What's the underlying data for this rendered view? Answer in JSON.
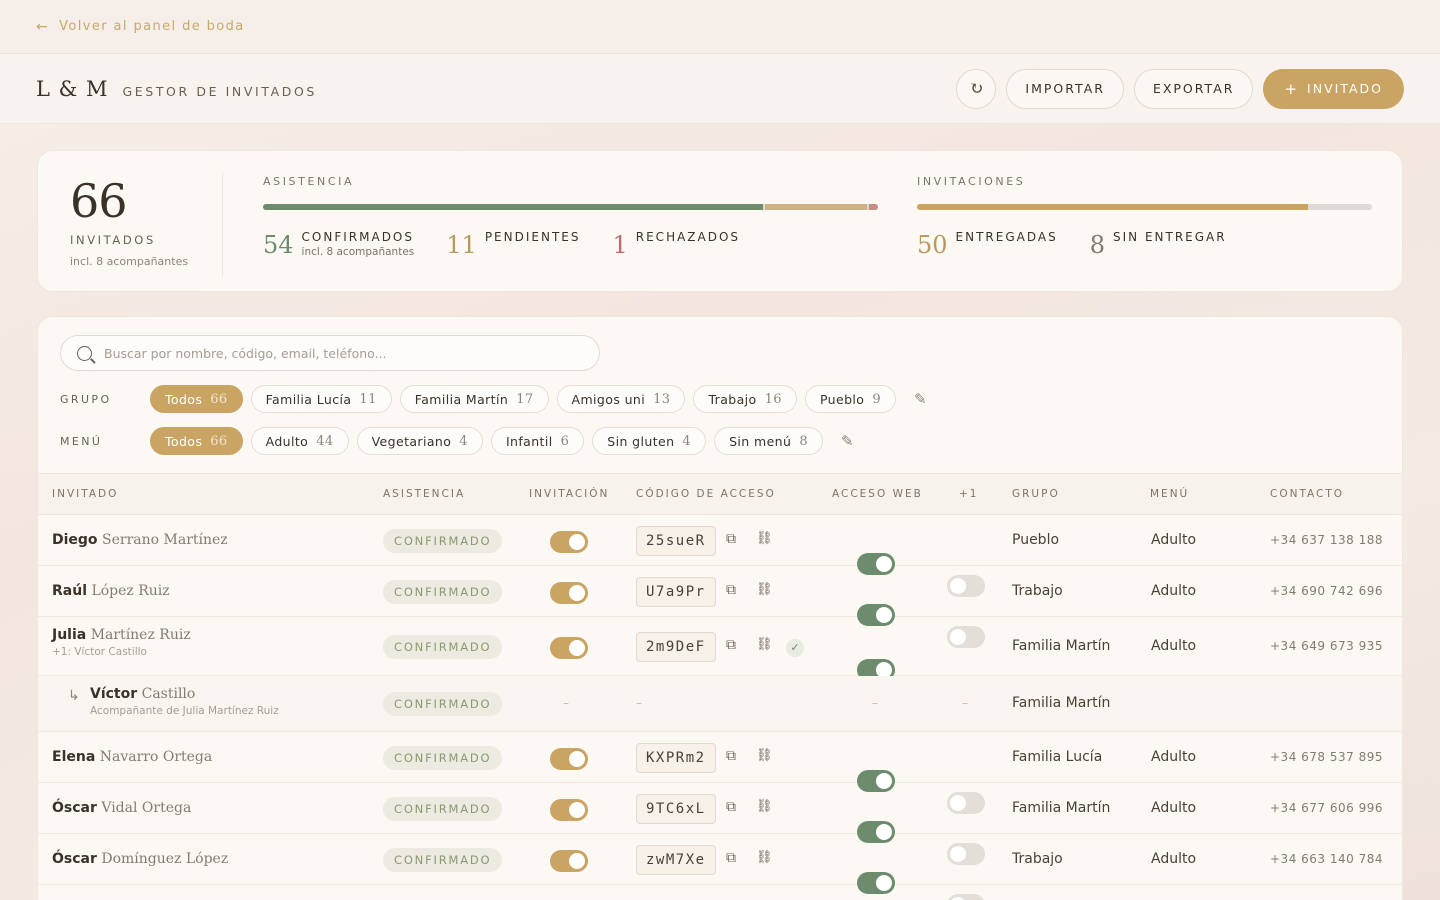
{
  "topbar": {
    "back_label": "Volver al panel de boda"
  },
  "header": {
    "logo": "L & M",
    "subtitle": "GESTOR DE INVITADOS",
    "import_label": "IMPORTAR",
    "export_label": "EXPORTAR",
    "add_label": "INVITADO"
  },
  "stats": {
    "total": "66",
    "total_label": "INVITADOS",
    "total_note": "incl. 8 acompañantes",
    "attendance_title": "ASISTENCIA",
    "confirmed": "54",
    "confirmed_label": "CONFIRMADOS",
    "confirmed_note": "incl. 8 acompañantes",
    "pending": "11",
    "pending_label": "PENDIENTES",
    "rejected": "1",
    "rejected_label": "RECHAZADOS",
    "invitations_title": "INVITACIONES",
    "delivered": "50",
    "delivered_label": "ENTREGADAS",
    "undelivered": "8",
    "undelivered_label": "SIN ENTREGAR",
    "colors": {
      "confirmed": "#6d8c6d",
      "pending": "#cdb285",
      "rejected": "#c98a8a",
      "delivered": "#c9a463",
      "undelivered": "#dedad5"
    }
  },
  "search": {
    "placeholder": "Buscar por nombre, código, email, teléfono..."
  },
  "filters": {
    "group_label": "GRUPO",
    "groups": [
      {
        "label": "Todos",
        "count": "66"
      },
      {
        "label": "Familia Lucía",
        "count": "11"
      },
      {
        "label": "Familia Martín",
        "count": "17"
      },
      {
        "label": "Amigos uni",
        "count": "13"
      },
      {
        "label": "Trabajo",
        "count": "16"
      },
      {
        "label": "Pueblo",
        "count": "9"
      }
    ],
    "menu_label": "MENÚ",
    "menus": [
      {
        "label": "Todos",
        "count": "66"
      },
      {
        "label": "Adulto",
        "count": "44"
      },
      {
        "label": "Vegetariano",
        "count": "4"
      },
      {
        "label": "Infantil",
        "count": "6"
      },
      {
        "label": "Sin gluten",
        "count": "4"
      },
      {
        "label": "Sin menú",
        "count": "8"
      }
    ]
  },
  "table": {
    "headers": {
      "guest": "INVITADO",
      "attendance": "ASISTENCIA",
      "invitation": "INVITACIÓN",
      "code": "CÓDIGO DE ACCESO",
      "web": "ACCESO WEB",
      "plus": "+1",
      "group": "GRUPO",
      "menu": "MENÚ",
      "contact": "CONTACTO"
    },
    "dash": "–",
    "rows": [
      {
        "first": "Diego",
        "last": "Serrano Martínez",
        "status": "CONFIRMADO",
        "code": "25sueR",
        "group": "Pueblo",
        "menu": "Adulto",
        "phone": "+34 637 138 188",
        "plus_one": false
      },
      {
        "first": "Raúl",
        "last": "López Ruiz",
        "status": "CONFIRMADO",
        "code": "U7a9Pr",
        "group": "Trabajo",
        "menu": "Adulto",
        "phone": "+34 690 742 696",
        "plus_one": false
      },
      {
        "first": "Julia",
        "last": "Martínez Ruiz",
        "note": "+1: Víctor Castillo",
        "status": "CONFIRMADO",
        "code": "2m9DeF",
        "group": "Familia Martín",
        "menu": "Adulto",
        "phone": "+34 649 673 935",
        "plus_one": true
      },
      {
        "first": "Víctor",
        "last": "Castillo",
        "note": "Acompañante de Julia Martínez Ruiz",
        "status": "CONFIRMADO",
        "group": "Familia Martín",
        "companion": true
      },
      {
        "first": "Elena",
        "last": "Navarro Ortega",
        "status": "CONFIRMADO",
        "code": "KXPRm2",
        "group": "Familia Lucía",
        "menu": "Adulto",
        "phone": "+34 678 537 895",
        "plus_one": false
      },
      {
        "first": "Óscar",
        "last": "Vidal Ortega",
        "status": "CONFIRMADO",
        "code": "9TC6xL",
        "group": "Familia Martín",
        "menu": "Adulto",
        "phone": "+34 677 606 996",
        "plus_one": false
      },
      {
        "first": "Óscar",
        "last": "Domínguez López",
        "status": "CONFIRMADO",
        "code": "zwM7Xe",
        "group": "Trabajo",
        "menu": "Adulto",
        "phone": "+34 663 140 784",
        "plus_one": false
      }
    ]
  }
}
